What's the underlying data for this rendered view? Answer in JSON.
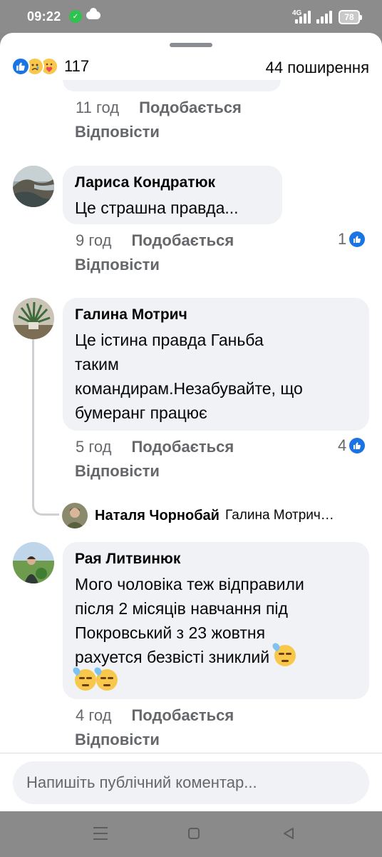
{
  "status_bar": {
    "time": "09:22",
    "network": "4G",
    "battery": "78"
  },
  "post_stats": {
    "reaction_icons": [
      "like-icon",
      "sad-icon",
      "care-icon"
    ],
    "reaction_count": "117",
    "shares": "44 поширення"
  },
  "top_comment": {
    "time": "11 год",
    "like_label": "Подобається",
    "reply_label": "Відповісти"
  },
  "comments": [
    {
      "name": "Лариса Кондратюк",
      "text": "Це страшна правда...",
      "time": "9 год",
      "like_label": "Подобається",
      "reply_label": "Відповісти",
      "likes": "1"
    },
    {
      "name": "Галина Мотрич",
      "text_lines": [
        "Це істина правда Ганьба",
        "таким",
        "командирам.Незабувайте, що",
        "бумеранг працює"
      ],
      "time": "5 год",
      "like_label": "Подобається",
      "reply_label": "Відповісти",
      "likes": "4"
    },
    {
      "name": "Рая Литвинюк",
      "text_lines": [
        "Мого чоловіка теж відправили",
        "після 2 місяців навчання під",
        "Покровський з 23 жовтня",
        "рахуется безвісті зниклий"
      ],
      "emojis": [
        "downcast-sweat-emoji",
        "downcast-sweat-emoji",
        "downcast-sweat-emoji"
      ],
      "time": "4 год",
      "like_label": "Подобається",
      "reply_label": "Відповісти"
    }
  ],
  "reply_preview": {
    "name": "Наталя Чорнобай",
    "text": "Галина Мотрич…"
  },
  "composer": {
    "placeholder": "Напишіть публічний коментар..."
  },
  "colors": {
    "accent": "#1b74e4",
    "bubble": "#f0f2f5",
    "secondary_text": "#65676b"
  }
}
